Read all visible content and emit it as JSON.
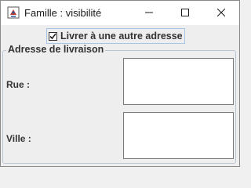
{
  "window": {
    "title": "Famille : visibilité",
    "icons": {
      "app": "java-app-icon",
      "minimize": "minimize-icon",
      "maximize": "maximize-icon",
      "close": "close-icon"
    }
  },
  "options": {
    "deliver_other_address": {
      "label": "Livrer à une autre adresse",
      "checked": true
    }
  },
  "delivery": {
    "legend": "Adresse de livraison",
    "street_label": "Rue :",
    "street_value": "",
    "city_label": "Ville :",
    "city_value": ""
  }
}
